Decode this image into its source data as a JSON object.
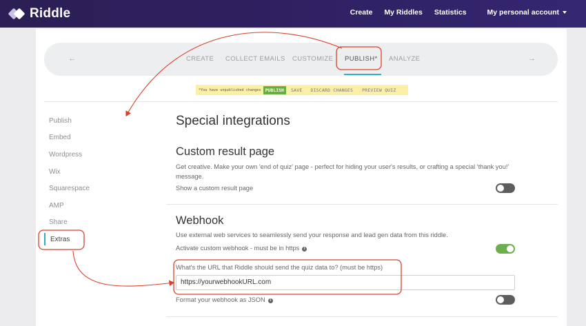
{
  "nav": {
    "brand": "Riddle",
    "links": [
      "Create",
      "My Riddles",
      "Statistics"
    ],
    "account": "My personal account"
  },
  "steps": {
    "prev_icon": "←",
    "next_icon": "→",
    "items": [
      "CREATE",
      "COLLECT EMAILS",
      "CUSTOMIZE",
      "PUBLISH*",
      "ANALYZE"
    ],
    "active": "PUBLISH*"
  },
  "notice": {
    "message": "*You have unpublished changes",
    "publish": "PUBLISH",
    "save": "SAVE",
    "discard": "DISCARD CHANGES",
    "preview": "PREVIEW QUIZ"
  },
  "sidebar": {
    "items": [
      "Publish",
      "Embed",
      "Wordpress",
      "Wix",
      "Squarespace",
      "AMP",
      "Share",
      "Extras"
    ],
    "active": "Extras"
  },
  "content": {
    "title": "Special integrations",
    "custom_result": {
      "heading": "Custom result page",
      "description": "Get creative. Make your own 'end of quiz' page - perfect for hiding your user's results, or crafting a special 'thank you!' message.",
      "toggle_label": "Show a custom result page",
      "toggle_on": false
    },
    "webhook": {
      "heading": "Webhook",
      "description": "Use external web services to seamlessly send your response and lead gen data from this riddle.",
      "activate_label": "Activate custom webhook - must be in https",
      "activate_on": true,
      "url_label": "What's the URL that Riddle should send the quiz data to? (must be https)",
      "url_value": "https://yourwebhookURL.com",
      "json_label": "Format your webhook as JSON",
      "json_on": false
    }
  },
  "colors": {
    "topbar": "#2e2060",
    "accent": "#27b3c4",
    "toggle_on": "#6dae4e",
    "annotation": "#d9412b",
    "notice_bg": "#fcefa6"
  }
}
